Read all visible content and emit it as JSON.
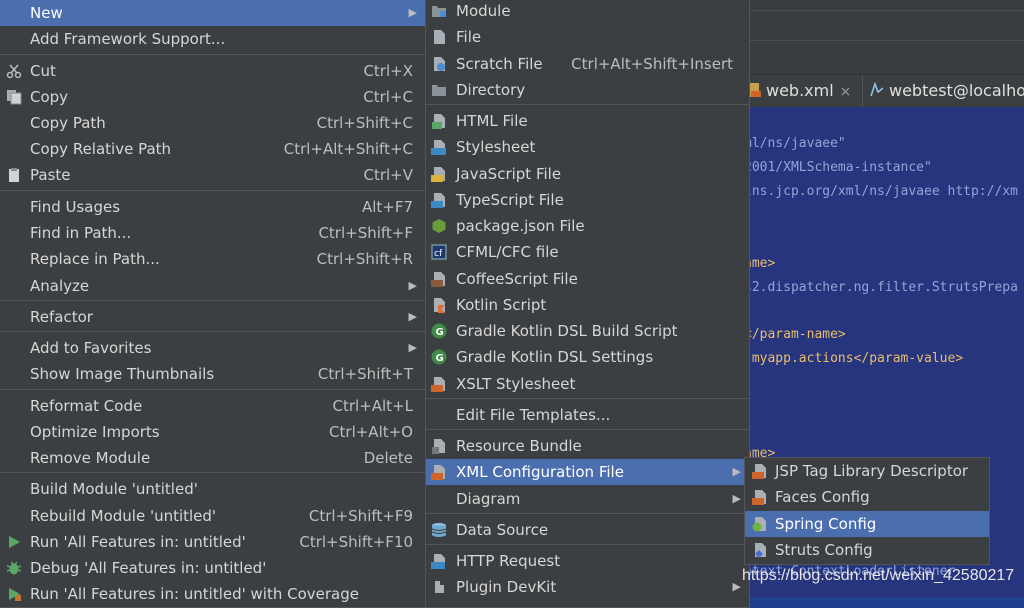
{
  "colors": {
    "menu_bg": "#3c3f41",
    "selection": "#4b6eaf",
    "editor_bg": "#27347e"
  },
  "main_menu": {
    "items": [
      {
        "label": "New",
        "shortcut": "",
        "submenu": true,
        "selected": true
      },
      {
        "label": "Add Framework Support...",
        "shortcut": ""
      },
      {
        "label": "Cut",
        "shortcut": "Ctrl+X",
        "icon": "scissors-icon"
      },
      {
        "label": "Copy",
        "shortcut": "Ctrl+C",
        "icon": "copy-icon"
      },
      {
        "label": "Copy Path",
        "shortcut": "Ctrl+Shift+C"
      },
      {
        "label": "Copy Relative Path",
        "shortcut": "Ctrl+Alt+Shift+C"
      },
      {
        "label": "Paste",
        "shortcut": "Ctrl+V",
        "icon": "clipboard-icon"
      },
      {
        "label": "Find Usages",
        "shortcut": "Alt+F7"
      },
      {
        "label": "Find in Path...",
        "shortcut": "Ctrl+Shift+F"
      },
      {
        "label": "Replace in Path...",
        "shortcut": "Ctrl+Shift+R"
      },
      {
        "label": "Analyze",
        "shortcut": "",
        "submenu": true
      },
      {
        "label": "Refactor",
        "shortcut": "",
        "submenu": true
      },
      {
        "label": "Add to Favorites",
        "shortcut": "",
        "submenu": true
      },
      {
        "label": "Show Image Thumbnails",
        "shortcut": "Ctrl+Shift+T"
      },
      {
        "label": "Reformat Code",
        "shortcut": "Ctrl+Alt+L"
      },
      {
        "label": "Optimize Imports",
        "shortcut": "Ctrl+Alt+O"
      },
      {
        "label": "Remove Module",
        "shortcut": "Delete"
      },
      {
        "label": "Build Module 'untitled'",
        "shortcut": ""
      },
      {
        "label": "Rebuild Module 'untitled'",
        "shortcut": "Ctrl+Shift+F9"
      },
      {
        "label": "Run 'All Features in: untitled'",
        "shortcut": "Ctrl+Shift+F10",
        "icon": "run-icon"
      },
      {
        "label": "Debug 'All Features in: untitled'",
        "shortcut": "",
        "icon": "debug-icon"
      },
      {
        "label": "Run 'All Features in: untitled' with Coverage",
        "shortcut": "",
        "icon": "coverage-icon"
      }
    ]
  },
  "new_menu": {
    "items": [
      {
        "label": "Module",
        "shortcut": "",
        "icon": "module-icon"
      },
      {
        "label": "File",
        "shortcut": "",
        "icon": "file-icon"
      },
      {
        "label": "Scratch File",
        "shortcut": "Ctrl+Alt+Shift+Insert",
        "icon": "scratch-file-icon"
      },
      {
        "label": "Directory",
        "shortcut": "",
        "icon": "folder-icon"
      },
      {
        "label": "HTML File",
        "shortcut": "",
        "icon": "html-file-icon"
      },
      {
        "label": "Stylesheet",
        "shortcut": "",
        "icon": "css-file-icon"
      },
      {
        "label": "JavaScript File",
        "shortcut": "",
        "icon": "js-file-icon"
      },
      {
        "label": "TypeScript File",
        "shortcut": "",
        "icon": "ts-file-icon"
      },
      {
        "label": "package.json File",
        "shortcut": "",
        "icon": "nodejs-icon"
      },
      {
        "label": "CFML/CFC file",
        "shortcut": "",
        "icon": "cfml-icon"
      },
      {
        "label": "CoffeeScript File",
        "shortcut": "",
        "icon": "coffeescript-icon"
      },
      {
        "label": "Kotlin Script",
        "shortcut": "",
        "icon": "kotlin-icon"
      },
      {
        "label": "Gradle Kotlin DSL Build Script",
        "shortcut": "",
        "icon": "gradle-icon"
      },
      {
        "label": "Gradle Kotlin DSL Settings",
        "shortcut": "",
        "icon": "gradle-icon"
      },
      {
        "label": "XSLT Stylesheet",
        "shortcut": "",
        "icon": "xslt-icon"
      },
      {
        "label": "Edit File Templates...",
        "shortcut": ""
      },
      {
        "label": "Resource Bundle",
        "shortcut": "",
        "icon": "resource-bundle-icon"
      },
      {
        "label": "XML Configuration File",
        "shortcut": "",
        "submenu": true,
        "selected": true,
        "icon": "xml-file-icon"
      },
      {
        "label": "Diagram",
        "shortcut": "",
        "submenu": true
      },
      {
        "label": "Data Source",
        "shortcut": "",
        "icon": "database-icon"
      },
      {
        "label": "HTTP Request",
        "shortcut": "",
        "icon": "api-icon"
      },
      {
        "label": "Plugin DevKit",
        "shortcut": "",
        "submenu": true,
        "icon": "plugin-icon"
      }
    ]
  },
  "xml_menu": {
    "items": [
      {
        "label": "JSP Tag Library Descriptor",
        "icon": "xml-file-icon"
      },
      {
        "label": "Faces Config",
        "icon": "jsf-icon"
      },
      {
        "label": "Spring Config",
        "icon": "spring-icon",
        "selected": true
      },
      {
        "label": "Struts Config",
        "icon": "struts-icon"
      }
    ]
  },
  "editor": {
    "tabs": [
      {
        "label": "web.xml",
        "close": "×"
      },
      {
        "label": "webtest@localhost"
      }
    ],
    "code_lines": [
      "ml/ns/javaee\"",
      "2001/XMLSchema-instance\"",
      "lns.jcp.org/xml/ns/javaee http://xm",
      "ame>",
      "s2.dispatcher.ng.filter.StrutsPrepa",
      "</param-name>",
      ".myapp.actions</param-value>",
      "ame>",
      "ntext.ContextLoaderListener"
    ]
  },
  "watermark": "https://blog.csdn.net/weixin_42580217"
}
